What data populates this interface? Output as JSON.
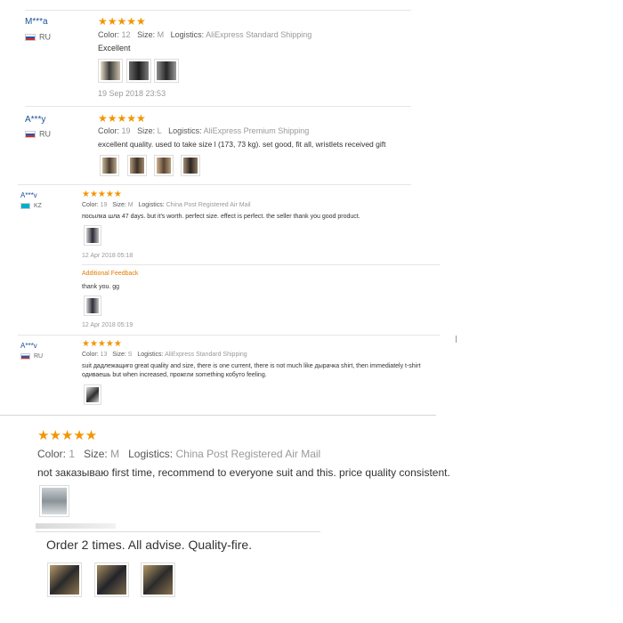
{
  "reviews": [
    {
      "user": "M***a",
      "country": "RU",
      "stars": "★★★★★",
      "color_label": "Color:",
      "color_value": "12",
      "size_label": "Size:",
      "size_value": "M",
      "logistics_label": "Logistics:",
      "logistics_value": "AliExpress Standard Shipping",
      "text": "Excellent",
      "date": "19 Sep 2018 23:53"
    },
    {
      "user": "A***y",
      "country": "RU",
      "stars": "★★★★★",
      "color_label": "Color:",
      "color_value": "19",
      "size_label": "Size:",
      "size_value": "L",
      "logistics_label": "Logistics:",
      "logistics_value": "AliExpress Premium Shipping",
      "text": "excellent quality. used to take size l (173, 73 kg). set good, fit all, wristlets received gift"
    },
    {
      "user": "A***v",
      "country": "KZ",
      "stars": "★★★★★",
      "color_label": "Color:",
      "color_value": "19",
      "size_label": "Size:",
      "size_value": "M",
      "logistics_label": "Logistics:",
      "logistics_value": "China Post Registered Air Mail",
      "text": "посылка шла 47 days. but it's worth. perfect size. effect is perfect. the seller thank you good product.",
      "date": "12 Apr 2018 05:18",
      "additional_label": "Additional Feedback",
      "additional_text": "thank you. gg",
      "additional_date": "12 Apr 2018 05:19"
    },
    {
      "user": "A***v",
      "country": "RU",
      "stars": "★★★★★",
      "color_label": "Color:",
      "color_value": "13",
      "size_label": "Size:",
      "size_value": "S",
      "logistics_label": "Logistics:",
      "logistics_value": "AliExpress Standard Shipping",
      "text_line1": "suit дадлежащиго great quality and size, there is one current, there is not much like дырачка shirt, then immediately t-shirt",
      "text_line2": "одиваешь but when increased, прожгли something кобуто feeling."
    },
    {
      "stars": "★★★★★",
      "color_label": "Color:",
      "color_value": "1",
      "size_label": "Size:",
      "size_value": "M",
      "logistics_label": "Logistics:",
      "logistics_value": "China Post Registered Air Mail",
      "text": "not заказываю first time, recommend to everyone suit and this. price quality consistent."
    },
    {
      "text": "Order 2 times. All advise. Quality-fire."
    }
  ],
  "colors": {
    "stars": "#f29500",
    "username": "#1a4f96",
    "additional_feedback": "#e07b00",
    "muted": "#999999"
  }
}
